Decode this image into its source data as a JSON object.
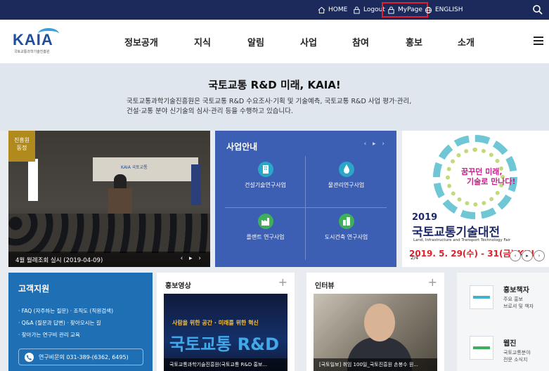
{
  "topbar": {
    "home": "HOME",
    "logout": "Logout",
    "mypage": "MyPage",
    "english": "ENGLISH"
  },
  "header": {
    "logo_word": "KAIA",
    "logo_sub": "국토교통과학기술진흥원",
    "nav": [
      "정보공개",
      "지식",
      "알림",
      "사업",
      "참여",
      "홍보",
      "소개"
    ]
  },
  "intro": {
    "title": "국토교통 R&D 미래, KAIA!",
    "line1": "국토교통과학기술진흥원은 국토교통 R&D 수요조사·기획 및 기술예측, 국토교통 R&D 사업 평가·관리,",
    "line2": "건설·교통 분야 신기술의 심사·관리 등을 수행하고 있습니다."
  },
  "photo_slide": {
    "tag": "진흥원\n동정",
    "caption": "4월 월례조회 실시 (2019-04-09)",
    "arrows": "‹ ▸ ›",
    "screen_text": "KAIA 국토교통"
  },
  "business": {
    "title": "사업안내",
    "arrows": "‹ ▸ ›",
    "items": [
      {
        "label": "건설기술연구사업",
        "icon": "building-icon",
        "color": "#2aa6c8"
      },
      {
        "label": "물관리연구사업",
        "icon": "water-drop-icon",
        "color": "#2aa6c8"
      },
      {
        "label": "플랜트 연구사업",
        "icon": "factory-icon",
        "color": "#3cb15a"
      },
      {
        "label": "도시건축 연구사업",
        "icon": "city-icon",
        "color": "#3cb15a"
      }
    ]
  },
  "festival": {
    "slogan1": "꿈꾸던 미래,",
    "slogan2": "기술로 만나다!",
    "year": "2019",
    "title": "국토교통기술대전",
    "en": "Land, Infrastructure and Transport Technology Fair",
    "date": "2019. 5. 29(수) - 31(금) KIN",
    "pager": "2/4"
  },
  "support": {
    "title": "고객지원",
    "links": [
      "· FAQ (자주하는 질문)   · 조직도 (직원검색)",
      "· Q&A (질문과 답변)      · 찾아오시는 길",
      "· 찾아가는 연구비 관리 교육"
    ],
    "phone": "연구비문의 031-389-(6362, 6495)"
  },
  "video": {
    "title": "홍보영상",
    "plus": "+",
    "banner_small": "사람을 위한 공간 · 미래를 위한 혁신",
    "banner_big": "국토교통 R&D",
    "caption": "국토교통과학기술진흥원(국토교통 R&D 홍보..."
  },
  "interview": {
    "title": "인터뷰",
    "plus": "+",
    "caption": "[국토일보] 취임 100일_국토진흥원 손봉수 원..."
  },
  "publications": [
    {
      "title": "홍보책자",
      "desc1": "주요 홍보",
      "desc2": "브로셔 및 책자"
    },
    {
      "title": "웹진",
      "desc1": "국토교통분야",
      "desc2": "전문 소식지"
    }
  ]
}
